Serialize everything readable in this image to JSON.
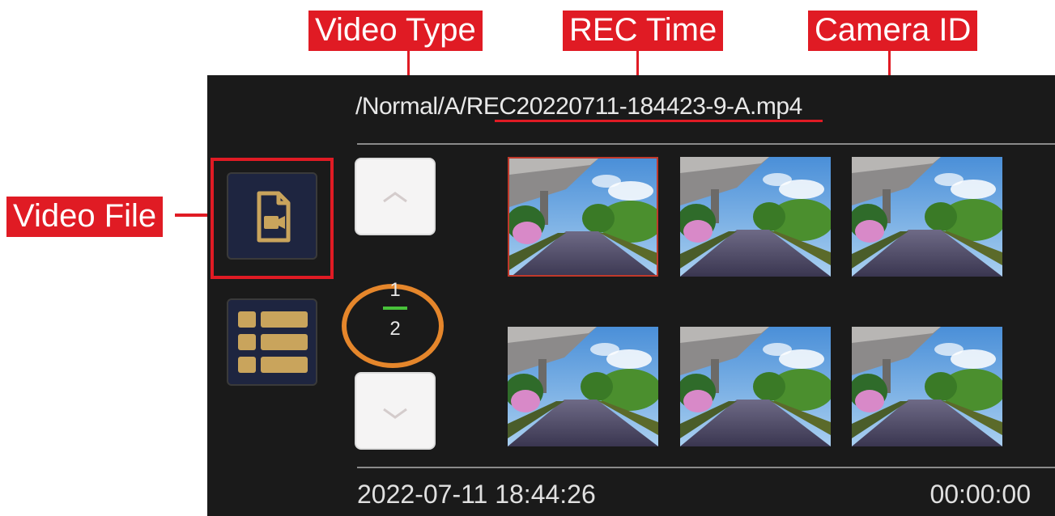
{
  "callouts": {
    "video_type": "Video Type",
    "rec_time": "REC Time",
    "camera_id": "Camera ID",
    "video_file": "Video File"
  },
  "screen": {
    "file_path": "/Normal/A/REC20220711-184423-9-A.mp4",
    "page": {
      "current": "1",
      "total": "2"
    },
    "thumbnails": [
      {
        "selected": true
      },
      {
        "selected": false
      },
      {
        "selected": false
      },
      {
        "selected": false
      },
      {
        "selected": false
      },
      {
        "selected": false
      }
    ],
    "footer": {
      "datetime": "2022-07-11 18:44:26",
      "duration": "00:00:00"
    }
  },
  "colors": {
    "callout": "#e01b24",
    "screen_bg": "#1a1a1a",
    "page_ring": "#e5862b",
    "page_bar": "#48c23a",
    "icon_gold": "#c9a45c"
  },
  "icons": {
    "video_file": "video-file-icon",
    "list_view": "list-view-icon",
    "up": "chevron-up-icon",
    "down": "chevron-down-icon"
  }
}
